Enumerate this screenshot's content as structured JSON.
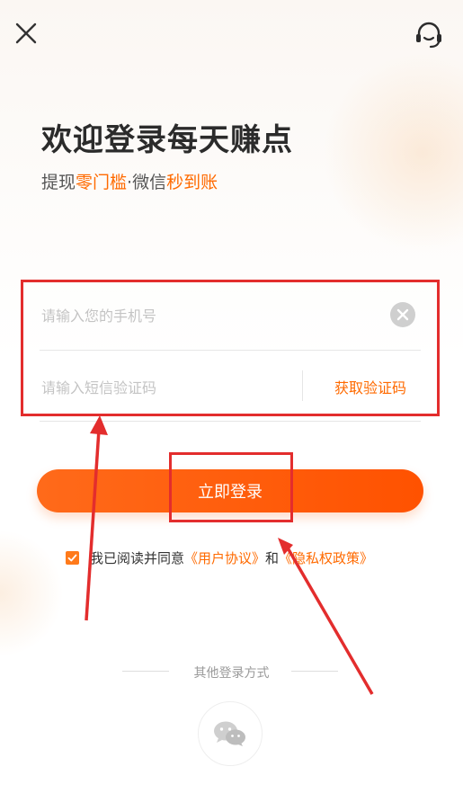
{
  "header": {
    "close_icon": "close-icon",
    "support_icon": "customer-service-icon"
  },
  "hero": {
    "title": "欢迎登录每天赚点",
    "subtitle_part1": "提现",
    "subtitle_highlight1": "零门槛",
    "subtitle_part2": "·微信",
    "subtitle_highlight2": "秒到账"
  },
  "form": {
    "phone_placeholder": "请输入您的手机号",
    "code_placeholder": "请输入短信验证码",
    "get_code_label": "获取验证码"
  },
  "login_button": {
    "label": "立即登录"
  },
  "agreement": {
    "prefix": "我已阅读并同意",
    "user_agreement": "《用户协议》",
    "and": "和",
    "privacy_policy": "《隐私权政策》",
    "checked": true
  },
  "other_login": {
    "label": "其他登录方式",
    "wechat_icon": "wechat-icon"
  },
  "colors": {
    "accent": "#ff6a00",
    "annotation": "#e32d2d"
  }
}
